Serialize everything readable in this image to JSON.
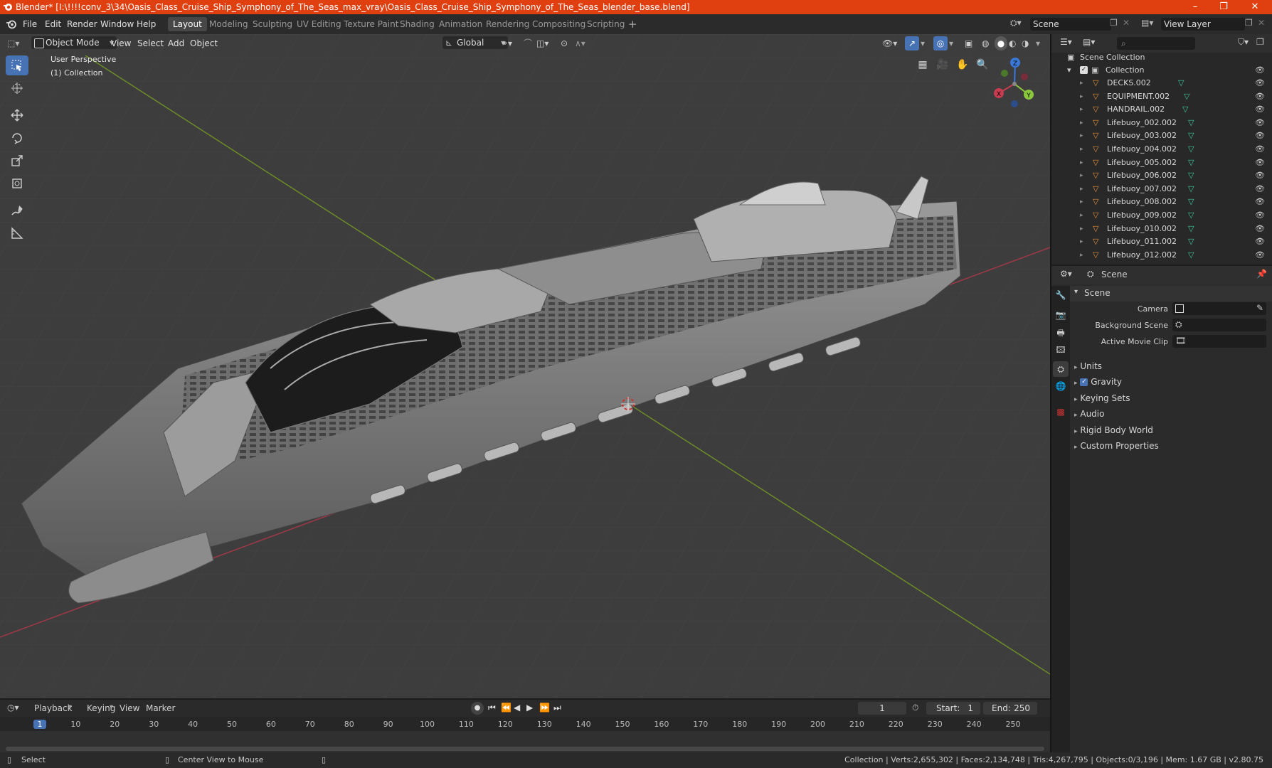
{
  "window": {
    "title": "Blender* [I:\\!!!!conv_3\\34\\Oasis_Class_Cruise_Ship_Symphony_of_The_Seas_max_vray\\Oasis_Class_Cruise_Ship_Symphony_of_The_Seas_blender_base.blend]",
    "controls": [
      "–",
      "❐",
      "✕"
    ]
  },
  "menu": [
    "File",
    "Edit",
    "Render",
    "Window",
    "Help"
  ],
  "workspaces": [
    "Layout",
    "Modeling",
    "Sculpting",
    "UV Editing",
    "Texture Paint",
    "Shading",
    "Animation",
    "Rendering",
    "Compositing",
    "Scripting"
  ],
  "active_workspace": "Layout",
  "top_right": {
    "scene": "Scene",
    "view_layer": "View Layer"
  },
  "viewport": {
    "mode": "Object Mode",
    "menus": [
      "View",
      "Select",
      "Add",
      "Object"
    ],
    "transform_orientation": "Global",
    "overlay_title": "User Perspective",
    "overlay_sub": "(1) Collection",
    "gizmo": {
      "x": "X",
      "y": "Y",
      "z": "Z"
    },
    "colors": {
      "x_axis": "#c83c50",
      "y_axis": "#8cc83c",
      "z_axis": "#3c78d8",
      "active_tool": "#4772b3"
    }
  },
  "outliner": {
    "root": "Scene Collection",
    "collection": "Collection",
    "items": [
      "DECKS.002",
      "EQUIPMENT.002",
      "HANDRAIL.002",
      "Lifebuoy_002.002",
      "Lifebuoy_003.002",
      "Lifebuoy_004.002",
      "Lifebuoy_005.002",
      "Lifebuoy_006.002",
      "Lifebuoy_007.002",
      "Lifebuoy_008.002",
      "Lifebuoy_009.002",
      "Lifebuoy_010.002",
      "Lifebuoy_011.002",
      "Lifebuoy_012.002"
    ]
  },
  "properties": {
    "header": "Scene",
    "panel": "Scene",
    "fields": [
      {
        "label": "Camera",
        "value": ""
      },
      {
        "label": "Background Scene",
        "value": ""
      },
      {
        "label": "Active Movie Clip",
        "value": ""
      }
    ],
    "sections": [
      "Units",
      "Gravity",
      "Keying Sets",
      "Audio",
      "Rigid Body World",
      "Custom Properties"
    ],
    "gravity_checked": true
  },
  "timeline": {
    "menus": [
      "Playback",
      "Keying",
      "View",
      "Marker"
    ],
    "current_frame": "1",
    "start_label": "Start:",
    "start": "1",
    "end_label": "End:",
    "end": "250",
    "ticks": [
      "1",
      "10",
      "20",
      "30",
      "40",
      "50",
      "60",
      "70",
      "80",
      "90",
      "100",
      "110",
      "120",
      "130",
      "140",
      "150",
      "160",
      "170",
      "180",
      "190",
      "200",
      "210",
      "220",
      "230",
      "240",
      "250"
    ]
  },
  "status": {
    "left": "Select",
    "middle": "Center View to Mouse",
    "right": "Collection | Verts:2,655,302 | Faces:2,134,748 | Tris:4,267,795 | Objects:0/3,196 | Mem: 1.67 GB | v2.80.75"
  }
}
